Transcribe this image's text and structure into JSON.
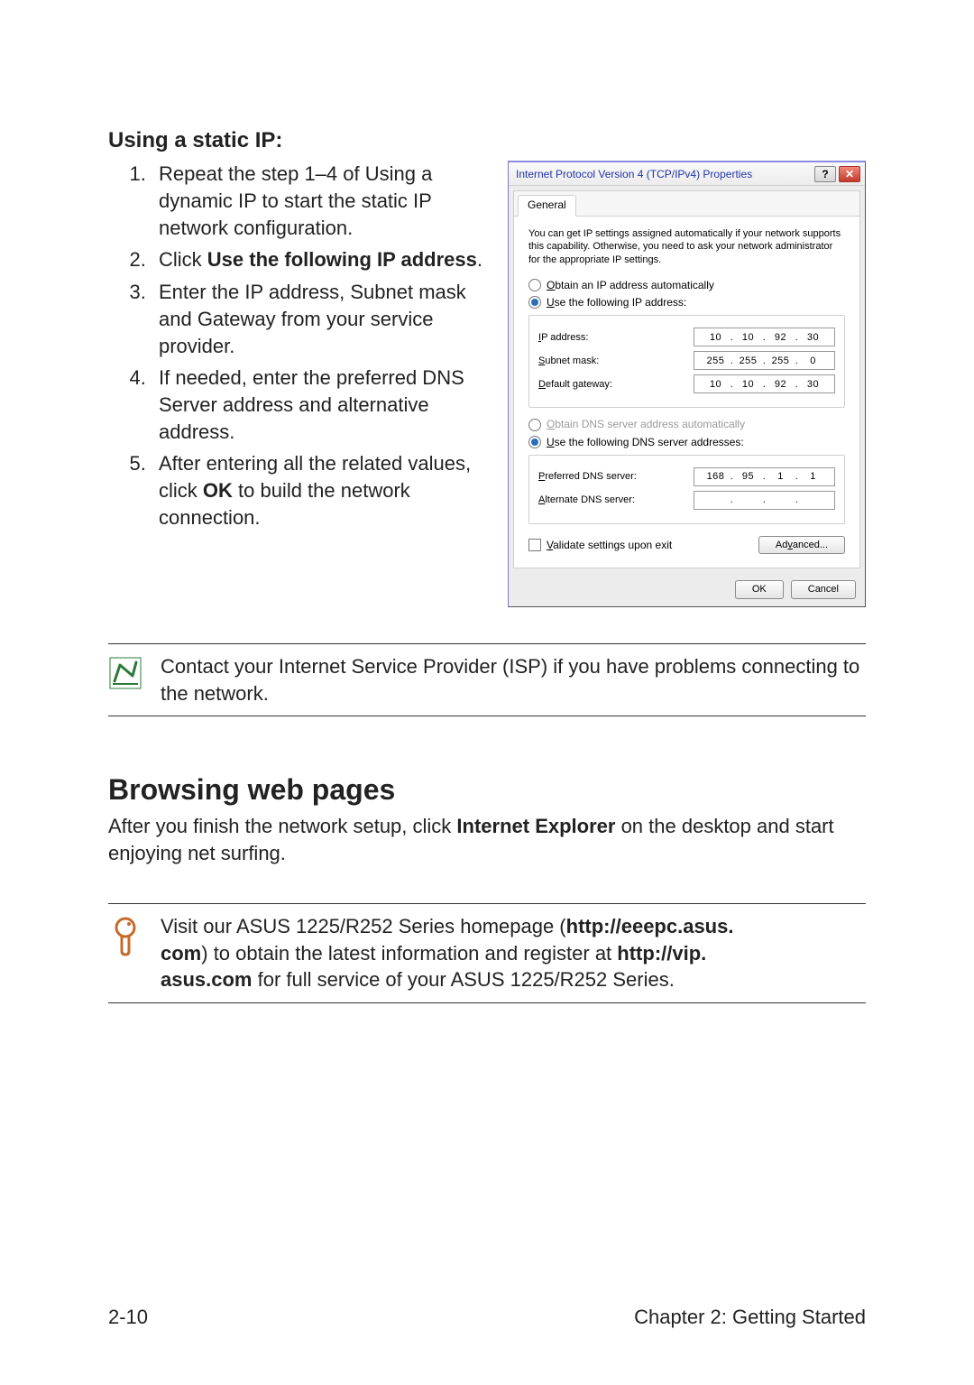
{
  "section1_heading": "Using a static IP:",
  "steps": [
    {
      "n": "1.",
      "html_parts": [
        "Repeat the step 1–4 of Using a dynamic IP to start the static IP network configuration."
      ]
    },
    {
      "n": "2",
      "prefix": "Click ",
      "bold": "Use the following IP address",
      "suffix": "."
    },
    {
      "n": "3.",
      "text": "Enter the IP address, Subnet mask and Gateway from your service provider."
    },
    {
      "n": "4.",
      "text": "If needed, enter the preferred DNS Server address and alternative address."
    },
    {
      "n": "5.",
      "prefix": "After entering all the related values, click ",
      "bold": "OK",
      "suffix": " to build the network connection."
    }
  ],
  "dialog": {
    "title": "Internet Protocol Version 4 (TCP/IPv4) Properties",
    "help_btn": "?",
    "close_btn": "✕",
    "tab_general": "General",
    "intro": "You can get IP settings assigned automatically if your network supports this capability. Otherwise, you need to ask your network administrator for the appropriate IP settings.",
    "radio_ip_auto_prefix": "O",
    "radio_ip_auto_label": "btain an IP address automatically",
    "radio_ip_use_prefix": "U",
    "radio_ip_use_rest": "se the following IP address:",
    "ip_label_prefix": "I",
    "ip_label_mid": "P address:",
    "subnet_label_prefix": "S",
    "subnet_label_mid": "ubnet mask:",
    "gateway_label_prefix": "D",
    "gateway_label_mid": "efault gateway:",
    "radio_dns_auto_prefix": "O",
    "radio_dns_auto_label": "btain DNS server address automatically",
    "radio_dns_use_prefix": "U",
    "radio_dns_use_rest": "se the following DNS server addresses:",
    "pref_dns_label_prefix": "P",
    "pref_dns_label_mid": "referred DNS server:",
    "alt_dns_label_prefix": "A",
    "alt_dns_label_mid": "lternate DNS server:",
    "ip": {
      "a": "10",
      "b": "10",
      "c": "92",
      "d": "30"
    },
    "subnet": {
      "a": "255",
      "b": "255",
      "c": "255",
      "d": "0"
    },
    "gateway": {
      "a": "10",
      "b": "10",
      "c": "92",
      "d": "30"
    },
    "pref_dns": {
      "a": "168",
      "b": "95",
      "c": "1",
      "d": "1"
    },
    "alt_dns": {
      "a": "",
      "b": "",
      "c": "",
      "d": ""
    },
    "validate_prefix": "V",
    "validate_rest": "alidate settings upon exit",
    "advanced_label": "Advanced...",
    "ok_label": "OK",
    "cancel_label": "Cancel"
  },
  "note1_text": "Contact your Internet Service Provider (ISP) if you have problems connecting to the network.",
  "section2_heading": "Browsing web pages",
  "browsing_prefix": "After you finish the network setup, click ",
  "browsing_bold": "Internet Explorer",
  "browsing_suffix": " on the desktop and start enjoying net surfing.",
  "tip_pre": "Visit our ASUS 1225/R252 Series homepage (",
  "tip_link1a": "http://eeepc.asus.",
  "tip_link1b": "com",
  "tip_mid1": ") to obtain the latest information and register at ",
  "tip_link2a": "http://vip.",
  "tip_link2b": "asus.com",
  "tip_suffix": " for full service of your ASUS 1225/R252 Series.",
  "footer_left": "2-10",
  "footer_right": "Chapter 2: Getting Started"
}
